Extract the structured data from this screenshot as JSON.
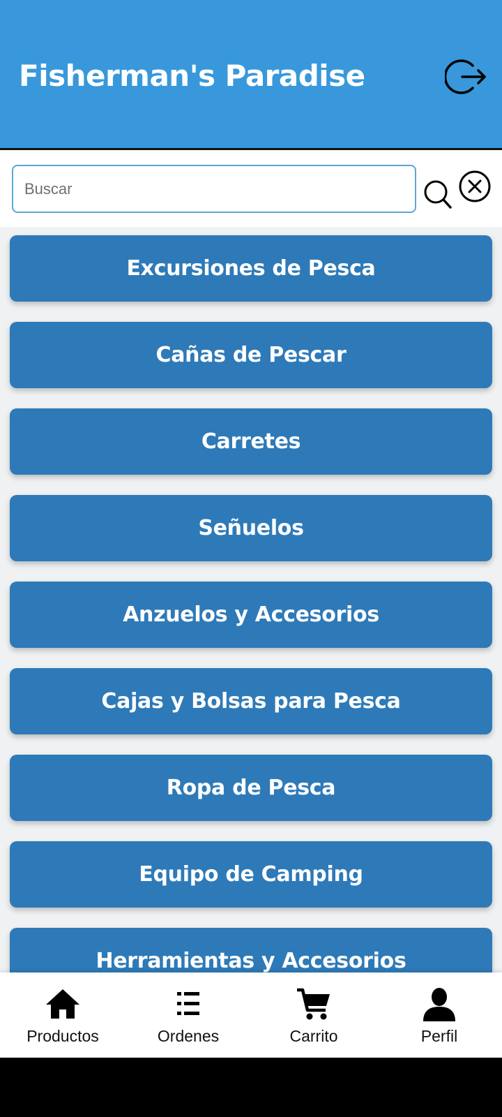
{
  "header": {
    "title": "Fisherman's Paradise",
    "logout_icon": "logout-icon"
  },
  "search": {
    "placeholder": "Buscar",
    "value": "",
    "search_icon": "search-icon",
    "clear_icon": "close-circle-icon"
  },
  "categories": [
    {
      "label": "Excursiones de Pesca"
    },
    {
      "label": "Cañas de Pescar"
    },
    {
      "label": "Carretes"
    },
    {
      "label": "Señuelos"
    },
    {
      "label": "Anzuelos y Accesorios"
    },
    {
      "label": "Cajas y Bolsas para Pesca"
    },
    {
      "label": "Ropa de Pesca"
    },
    {
      "label": "Equipo de Camping"
    },
    {
      "label": "Herramientas y Accesorios"
    }
  ],
  "bottom_nav": [
    {
      "label": "Productos",
      "icon": "home-icon"
    },
    {
      "label": "Ordenes",
      "icon": "list-icon"
    },
    {
      "label": "Carrito",
      "icon": "cart-icon"
    },
    {
      "label": "Perfil",
      "icon": "user-icon"
    }
  ],
  "colors": {
    "header": "#3898db",
    "category_button": "#2e7ab8",
    "background": "#eff1f3",
    "input_border": "#5aa6d6"
  }
}
